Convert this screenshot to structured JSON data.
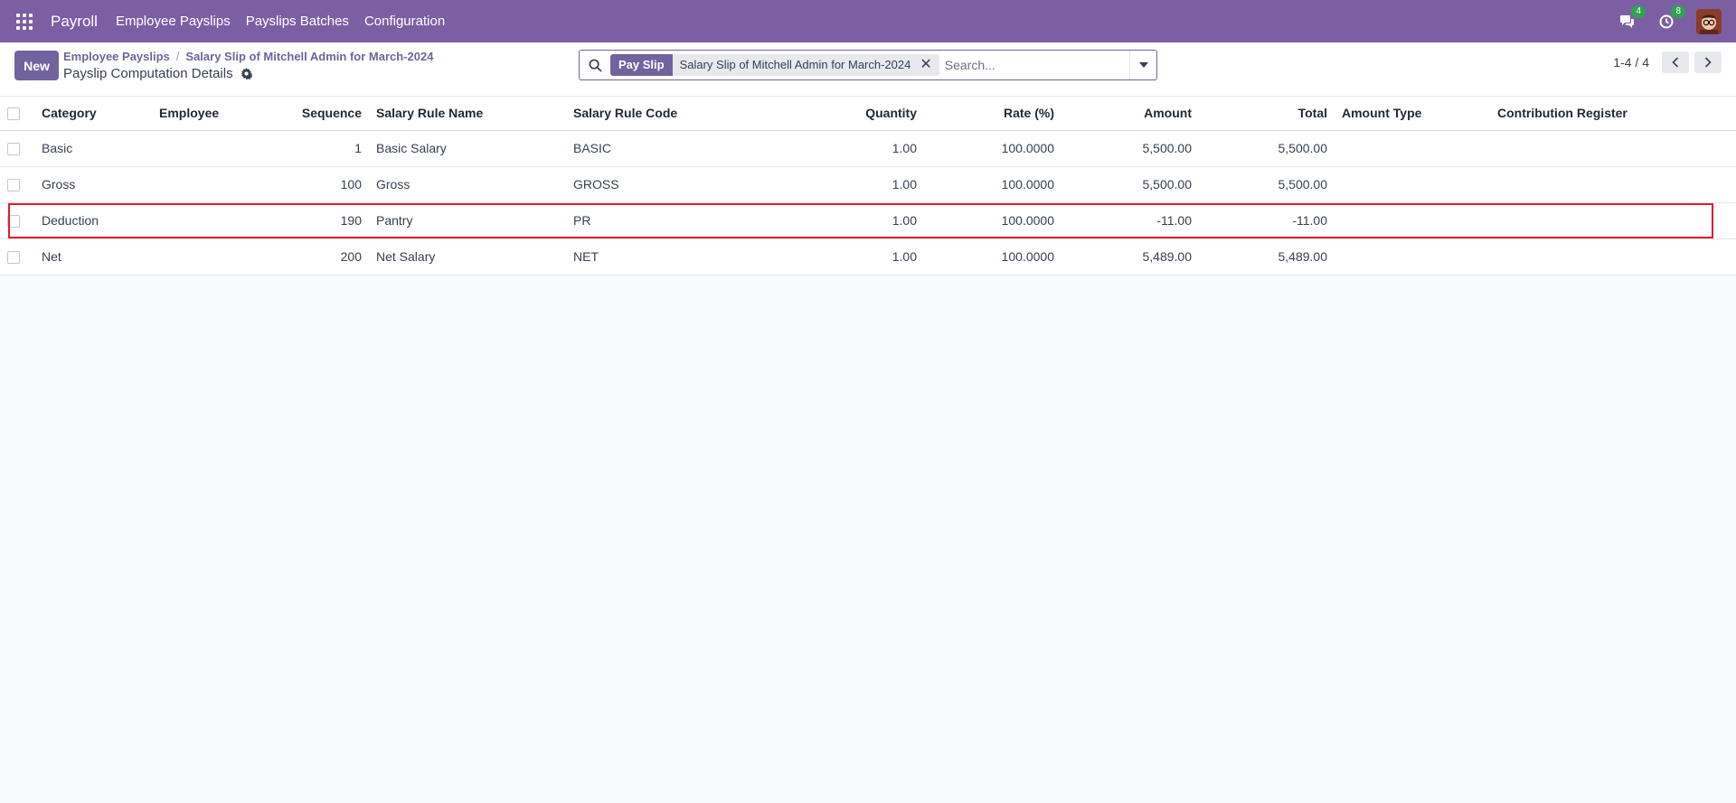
{
  "navbar": {
    "brand": "Payroll",
    "menu": [
      "Employee Payslips",
      "Payslips Batches",
      "Configuration"
    ],
    "messages_count": "4",
    "activities_count": "8"
  },
  "control": {
    "new_label": "New",
    "breadcrumb": [
      "Employee Payslips",
      "Salary Slip of Mitchell Admin for March-2024"
    ],
    "title": "Payslip Computation Details",
    "search": {
      "facet_label": "Pay Slip",
      "facet_value": "Salary Slip of Mitchell Admin for March-2024",
      "placeholder": "Search..."
    },
    "pager": "1-4 / 4"
  },
  "table": {
    "columns": [
      "Category",
      "Employee",
      "Sequence",
      "Salary Rule Name",
      "Salary Rule Code",
      "Quantity",
      "Rate (%)",
      "Amount",
      "Total",
      "Amount Type",
      "Contribution Register"
    ],
    "rows": [
      {
        "category": "Basic",
        "employee": "",
        "sequence": "1",
        "name": "Basic Salary",
        "code": "BASIC",
        "quantity": "1.00",
        "rate": "100.0000",
        "amount": "5,500.00",
        "total": "5,500.00",
        "amount_type": "",
        "register": ""
      },
      {
        "category": "Gross",
        "employee": "",
        "sequence": "100",
        "name": "Gross",
        "code": "GROSS",
        "quantity": "1.00",
        "rate": "100.0000",
        "amount": "5,500.00",
        "total": "5,500.00",
        "amount_type": "",
        "register": ""
      },
      {
        "category": "Deduction",
        "employee": "",
        "sequence": "190",
        "name": "Pantry",
        "code": "PR",
        "quantity": "1.00",
        "rate": "100.0000",
        "amount": "-11.00",
        "total": "-11.00",
        "amount_type": "",
        "register": ""
      },
      {
        "category": "Net",
        "employee": "",
        "sequence": "200",
        "name": "Net Salary",
        "code": "NET",
        "quantity": "1.00",
        "rate": "100.0000",
        "amount": "5,489.00",
        "total": "5,489.00",
        "amount_type": "",
        "register": ""
      }
    ]
  },
  "colors": {
    "navbar": "#7c5fa3",
    "primary": "#71639e",
    "badge": "#2ea44f",
    "highlight": "#e11d2e"
  }
}
